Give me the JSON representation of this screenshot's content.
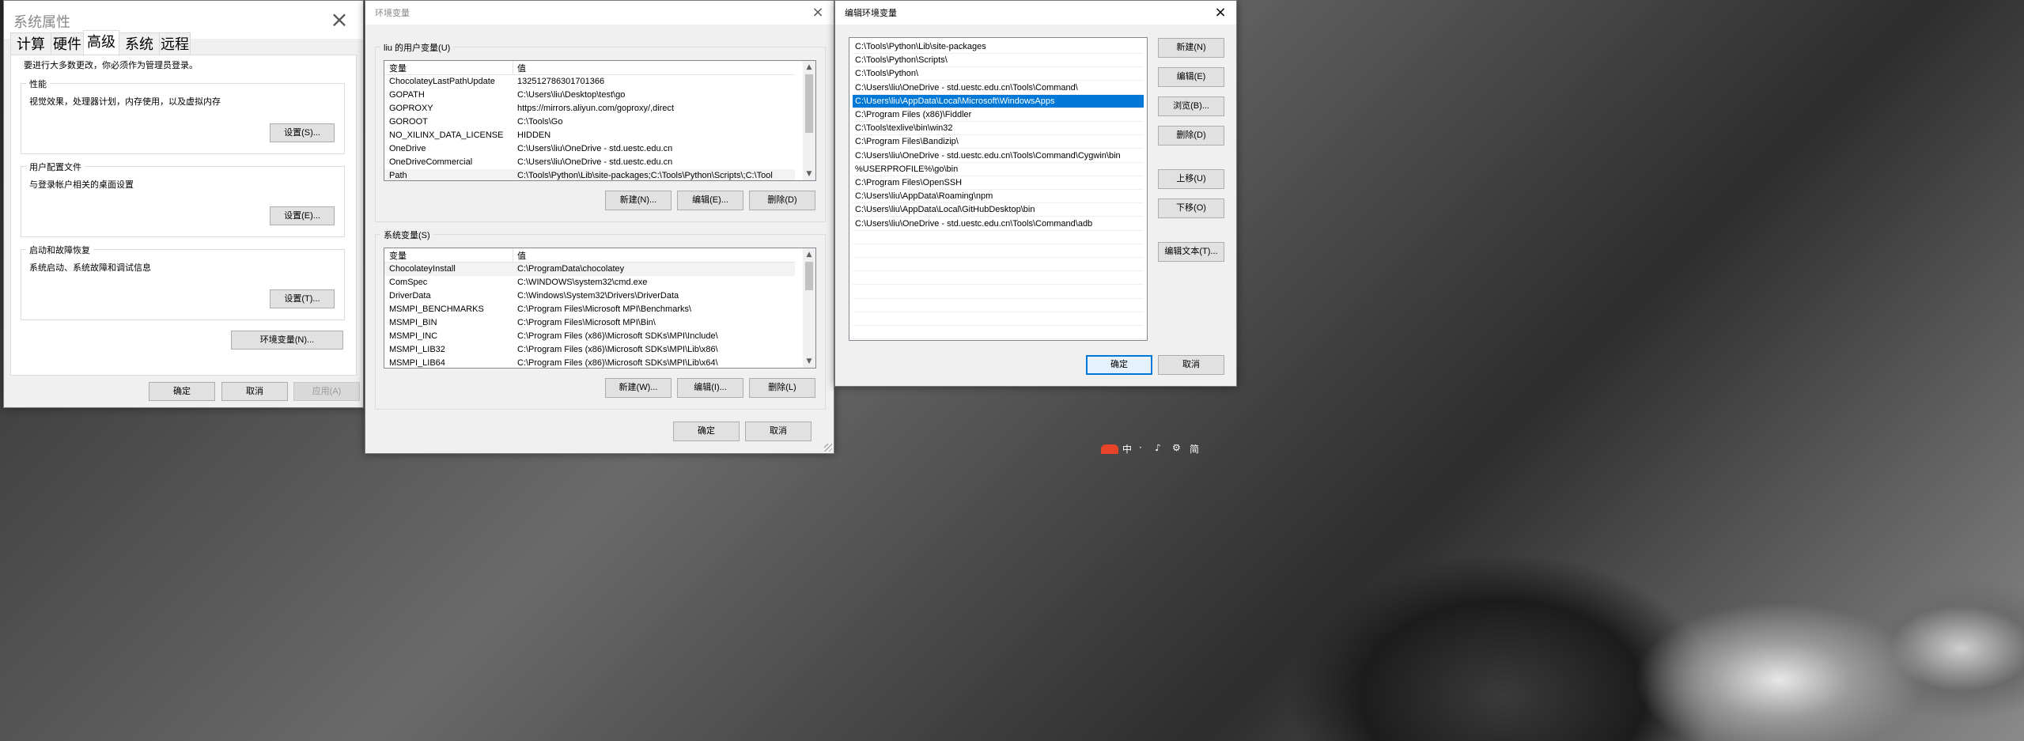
{
  "sysprops": {
    "title": "系统属性",
    "tabs": [
      "计算机名",
      "硬件",
      "高级",
      "系统保护",
      "远程"
    ],
    "active_tab": "高级",
    "admin_note": "要进行大多数更改，你必须作为管理员登录。",
    "performance": {
      "label": "性能",
      "desc": "视觉效果，处理器计划，内存使用，以及虚拟内存",
      "button": "设置(S)..."
    },
    "profile": {
      "label": "用户配置文件",
      "desc": "与登录帐户相关的桌面设置",
      "button": "设置(E)..."
    },
    "startup": {
      "label": "启动和故障恢复",
      "desc": "系统启动、系统故障和调试信息",
      "button": "设置(T)..."
    },
    "env_button": "环境变量(N)...",
    "ok": "确定",
    "cancel": "取消",
    "apply": "应用(A)"
  },
  "envvars": {
    "title": "环境变量",
    "user_group": "liu 的用户变量(U)",
    "system_group": "系统变量(S)",
    "col_var": "变量",
    "col_val": "值",
    "user_vars": [
      {
        "name": "ChocolateyLastPathUpdate",
        "value": "132512786301701366"
      },
      {
        "name": "GOPATH",
        "value": "C:\\Users\\liu\\Desktop\\test\\go"
      },
      {
        "name": "GOPROXY",
        "value": "https://mirrors.aliyun.com/goproxy/,direct"
      },
      {
        "name": "GOROOT",
        "value": "C:\\Tools\\Go"
      },
      {
        "name": "NO_XILINX_DATA_LICENSE",
        "value": "HIDDEN"
      },
      {
        "name": "OneDrive",
        "value": "C:\\Users\\liu\\OneDrive - std.uestc.edu.cn"
      },
      {
        "name": "OneDriveCommercial",
        "value": "C:\\Users\\liu\\OneDrive - std.uestc.edu.cn"
      },
      {
        "name": "Path",
        "value": "C:\\Tools\\Python\\Lib\\site-packages;C:\\Tools\\Python\\Scripts\\;C:\\Tool"
      }
    ],
    "system_vars": [
      {
        "name": "ChocolateyInstall",
        "value": "C:\\ProgramData\\chocolatey"
      },
      {
        "name": "ComSpec",
        "value": "C:\\WINDOWS\\system32\\cmd.exe"
      },
      {
        "name": "DriverData",
        "value": "C:\\Windows\\System32\\Drivers\\DriverData"
      },
      {
        "name": "MSMPI_BENCHMARKS",
        "value": "C:\\Program Files\\Microsoft MPI\\Benchmarks\\"
      },
      {
        "name": "MSMPI_BIN",
        "value": "C:\\Program Files\\Microsoft MPI\\Bin\\"
      },
      {
        "name": "MSMPI_INC",
        "value": "C:\\Program Files (x86)\\Microsoft SDKs\\MPI\\Include\\"
      },
      {
        "name": "MSMPI_LIB32",
        "value": "C:\\Program Files (x86)\\Microsoft SDKs\\MPI\\Lib\\x86\\"
      },
      {
        "name": "MSMPI_LIB64",
        "value": "C:\\Program Files (x86)\\Microsoft SDKs\\MPI\\Lib\\x64\\"
      }
    ],
    "user_buttons": {
      "new": "新建(N)...",
      "edit": "编辑(E)...",
      "delete": "删除(D)"
    },
    "system_buttons": {
      "new": "新建(W)...",
      "edit": "编辑(I)...",
      "delete": "删除(L)"
    },
    "ok": "确定",
    "cancel": "取消"
  },
  "editenv": {
    "title": "编辑环境变量",
    "paths": [
      "C:\\Tools\\Python\\Lib\\site-packages",
      "C:\\Tools\\Python\\Scripts\\",
      "C:\\Tools\\Python\\",
      "C:\\Users\\liu\\OneDrive - std.uestc.edu.cn\\Tools\\Command\\",
      "C:\\Users\\liu\\AppData\\Local\\Microsoft\\WindowsApps",
      "C:\\Program Files (x86)\\Fiddler",
      "C:\\Tools\\texlive\\bin\\win32",
      "C:\\Program Files\\Bandizip\\",
      "C:\\Users\\liu\\OneDrive - std.uestc.edu.cn\\Tools\\Command\\Cygwin\\bin",
      "%USERPROFILE%\\go\\bin",
      "C:\\Program Files\\OpenSSH",
      "C:\\Users\\liu\\AppData\\Roaming\\npm",
      "C:\\Users\\liu\\AppData\\Local\\GitHubDesktop\\bin",
      "C:\\Users\\liu\\OneDrive - std.uestc.edu.cn\\Tools\\Command\\adb"
    ],
    "selected_index": 4,
    "buttons": {
      "new": "新建(N)",
      "edit": "编辑(E)",
      "browse": "浏览(B)...",
      "delete": "删除(D)",
      "up": "上移(U)",
      "down": "下移(O)",
      "edit_text": "编辑文本(T)..."
    },
    "ok": "确定",
    "cancel": "取消"
  },
  "tray": [
    "中",
    "·",
    "♪",
    "⚙",
    "简"
  ]
}
